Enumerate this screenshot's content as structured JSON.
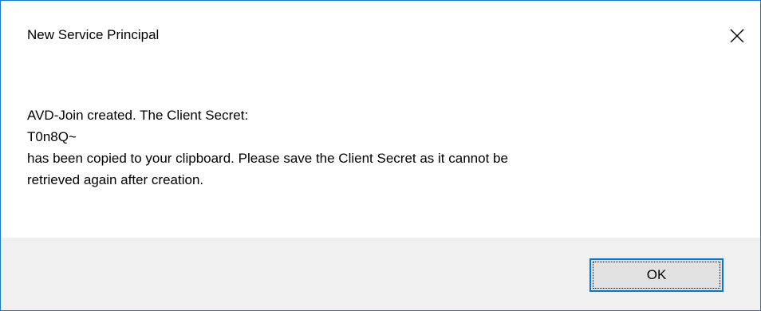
{
  "dialog": {
    "title": "New Service Principal",
    "close_icon": "close-icon"
  },
  "message": {
    "line1": "AVD-Join created. The Client Secret:",
    "line2": "T0n8Q~",
    "line3": "has been copied to your clipboard. Please save the Client Secret as it cannot be",
    "line4": "retrieved again after creation."
  },
  "buttons": {
    "ok_label": "OK"
  }
}
